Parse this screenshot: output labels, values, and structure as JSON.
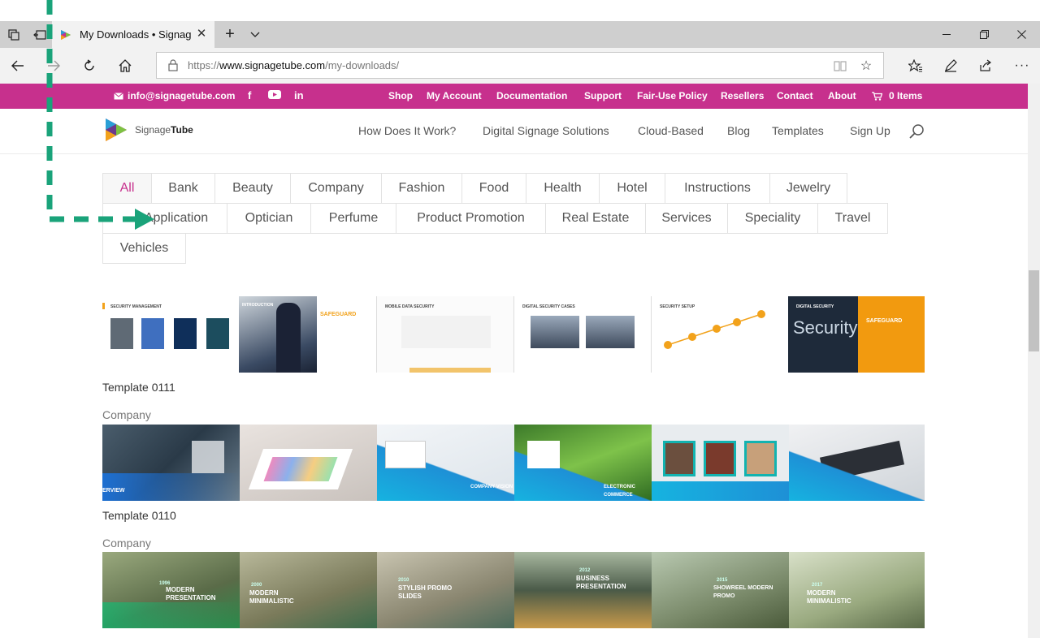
{
  "browser": {
    "tab_title": "My Downloads • Signag",
    "url_prefix": "https://",
    "url_domain": "www.signagetube.com",
    "url_path": "/my-downloads/"
  },
  "topbar": {
    "email": "info@signagetube.com",
    "nav": [
      "Shop",
      "My Account",
      "Documentation",
      "Support",
      "Fair-Use Policy",
      "Resellers",
      "Contact",
      "About"
    ],
    "cart": "0 Items",
    "color": "#c7308d"
  },
  "header": {
    "logo_part1": "Signage",
    "logo_part2": "Tube",
    "nav": [
      "How Does It Work?",
      "Digital Signage Solutions",
      "Cloud-Based",
      "Blog",
      "Templates",
      "Sign Up"
    ]
  },
  "filters": {
    "row1": [
      "All",
      "Bank",
      "Beauty",
      "Company",
      "Fashion",
      "Food",
      "Health",
      "Hotel",
      "Instructions",
      "Jewelry"
    ],
    "row2": [
      "Application",
      "Optician",
      "Perfume",
      "Product Promotion",
      "Real Estate",
      "Services",
      "Speciality",
      "Travel"
    ],
    "row3": [
      "Vehicles"
    ]
  },
  "templates": [
    {
      "captions": [
        "Security Management",
        "Introduction",
        "Mobile Data Security",
        "Digital Security Cases",
        "Security Setup",
        "Digital Security"
      ],
      "safeguard": "SAFEGUARD",
      "security_word": "Security"
    },
    {
      "title": "Template 0111",
      "category": "Company",
      "captions": [
        "ERVIEW",
        "",
        "COMPANY VISION",
        "ELECTRONIC COMMERCE",
        "",
        ""
      ]
    },
    {
      "title": "Template 0110",
      "category": "Company",
      "captions": [
        "MODERN PRESENTATION",
        "MODERN MINIMALISTIC",
        "STYLISH PROMO SLIDES",
        "BUSINESS PRESENTATION",
        "SHOWREEL MODERN PROMO",
        "MODERN MINIMALISTIC"
      ],
      "years": [
        "1996",
        "2000",
        "2010",
        "2012",
        "2015",
        "2017"
      ]
    }
  ],
  "colors": {
    "accent": "#c7308d",
    "arrow": "#1aa37a"
  }
}
